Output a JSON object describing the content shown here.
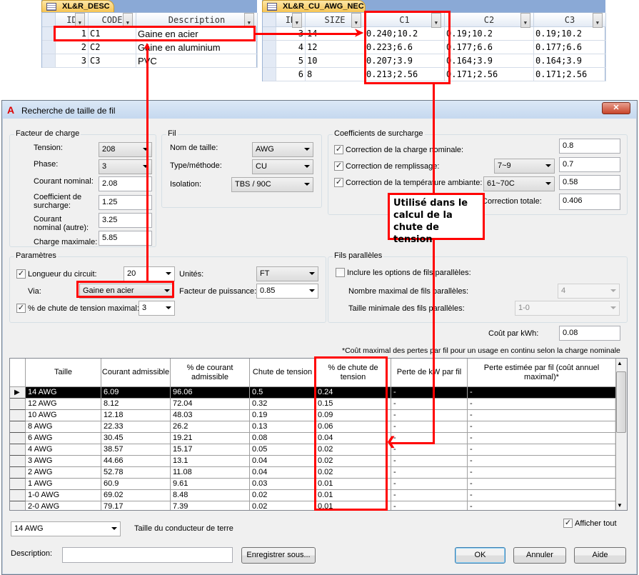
{
  "desc_table": {
    "tab": "XL&R_DESC",
    "columns": [
      "ID",
      "CODE",
      "Description"
    ],
    "rows": [
      [
        "1",
        "C1",
        "Gaine en acier"
      ],
      [
        "2",
        "C2",
        "Gaine en aluminium"
      ],
      [
        "3",
        "C3",
        "PVC"
      ]
    ]
  },
  "nec_table": {
    "tab": "XL&R_CU_AWG_NEC",
    "columns": [
      "ID",
      "SIZE",
      "C1",
      "C2",
      "C3"
    ],
    "rows": [
      [
        "3",
        "14",
        "0.240;10.2",
        "0.19;10.2",
        "0.19;10.2"
      ],
      [
        "4",
        "12",
        "0.223;6.6",
        "0.177;6.6",
        "0.177;6.6"
      ],
      [
        "5",
        "10",
        "0.207;3.9",
        "0.164;3.9",
        "0.164;3.9"
      ],
      [
        "6",
        "8",
        "0.213;2.56",
        "0.171;2.56",
        "0.171;2.56"
      ]
    ]
  },
  "callout": "Utilisé dans le calcul de la chute de tension",
  "annotation_color": "#ff0000",
  "dialog": {
    "title": "Recherche de taille de fil",
    "facteur": {
      "title": "Facteur de charge",
      "tension_label": "Tension:",
      "tension": "208",
      "phase_label": "Phase:",
      "phase": "3",
      "courant_label": "Courant nominal:",
      "courant": "2.08",
      "coef_label": "Coefficient de surcharge:",
      "coef": "1.25",
      "courant_autre_label": "Courant nominal (autre):",
      "courant_autre": "3.25",
      "charge_label": "Charge maximale:",
      "charge": "5.85"
    },
    "fil": {
      "title": "Fil",
      "nom_label": "Nom de taille:",
      "nom": "AWG",
      "type_label": "Type/méthode:",
      "type": "CU",
      "isolation_label": "Isolation:",
      "isolation": "TBS / 90C"
    },
    "coef": {
      "title": "Coefficients de surcharge",
      "charge_label": "Correction de la charge nominale:",
      "charge": "0.8",
      "remp_label": "Correction de remplissage:",
      "remp_sel": "7~9",
      "remp": "0.7",
      "temp_label": "Correction de la température ambiante:",
      "temp_sel": "61~70C",
      "temp": "0.58",
      "total_label": "Correction totale:",
      "total": "0.406"
    },
    "params": {
      "title": "Paramètres",
      "longueur_label": "Longueur du circuit:",
      "longueur": "20",
      "unites_label": "Unités:",
      "unites": "FT",
      "via_label": "Via:",
      "via": "Gaine en acier",
      "fp_label": "Facteur de puissance:",
      "fp": "0.85",
      "chute_label": "% de chute de tension maximal:",
      "chute": "3"
    },
    "paralleles": {
      "title": "Fils parallèles",
      "inclure_label": "Inclure les options de fils parallèles:",
      "nombre_label": "Nombre maximal de fils parallèles:",
      "nombre": "4",
      "taille_label": "Taille minimale des fils parallèles:",
      "taille": "1-0"
    },
    "cout_label": "Coût par kWh:",
    "cout": "0.08",
    "note": "*Coût maximal des pertes par fil pour un usage en continu selon la charge nominale",
    "grid": {
      "columns": [
        "Taille",
        "Courant admissible",
        "% de courant admissible",
        "Chute de tension",
        "% de chute de tension",
        "Perte de kW par fil",
        "Perte estimée par fil (coût annuel maximal)*"
      ],
      "rows": [
        [
          "14 AWG",
          "6.09",
          "96.06",
          "0.5",
          "0.24",
          "-",
          "-"
        ],
        [
          "12 AWG",
          "8.12",
          "72.04",
          "0.32",
          "0.15",
          "-",
          "-"
        ],
        [
          "10 AWG",
          "12.18",
          "48.03",
          "0.19",
          "0.09",
          "-",
          "-"
        ],
        [
          "8 AWG",
          "22.33",
          "26.2",
          "0.13",
          "0.06",
          "-",
          "-"
        ],
        [
          "6 AWG",
          "30.45",
          "19.21",
          "0.08",
          "0.04",
          "-",
          "-"
        ],
        [
          "4 AWG",
          "38.57",
          "15.17",
          "0.05",
          "0.02",
          "-",
          "-"
        ],
        [
          "3 AWG",
          "44.66",
          "13.1",
          "0.04",
          "0.02",
          "-",
          "-"
        ],
        [
          "2 AWG",
          "52.78",
          "11.08",
          "0.04",
          "0.02",
          "-",
          "-"
        ],
        [
          "1 AWG",
          "60.9",
          "9.61",
          "0.03",
          "0.01",
          "-",
          "-"
        ],
        [
          "1-0 AWG",
          "69.02",
          "8.48",
          "0.02",
          "0.01",
          "-",
          "-"
        ],
        [
          "2-0 AWG",
          "79.17",
          "7.39",
          "0.02",
          "0.01",
          "-",
          "-"
        ]
      ]
    },
    "terre": "14 AWG",
    "terre_label": "Taille du conducteur de terre",
    "afficher_label": "Afficher tout",
    "description_label": "Description:",
    "description": "",
    "save": "Enregistrer sous...",
    "ok": "OK",
    "cancel": "Annuler",
    "help": "Aide"
  }
}
